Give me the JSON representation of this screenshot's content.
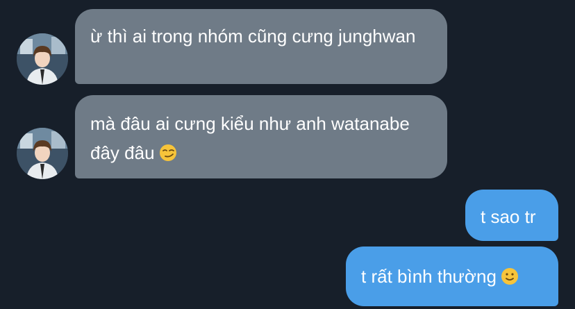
{
  "messages": [
    {
      "direction": "incoming",
      "text": "ừ thì ai trong nhóm cũng cưng junghwan"
    },
    {
      "direction": "incoming",
      "text": "mà đâu ai cưng kiểu như anh watanabe đây đâu",
      "emoji": "smirk-emoji"
    },
    {
      "direction": "outgoing",
      "text": "t sao tr"
    },
    {
      "direction": "outgoing",
      "text": "t rất bình thường",
      "emoji": "slightly-smiling-emoji"
    }
  ],
  "colors": {
    "background": "#171f2a",
    "incoming_bubble": "#6f7b87",
    "outgoing_bubble": "#4a9ee8",
    "text": "#ffffff"
  }
}
